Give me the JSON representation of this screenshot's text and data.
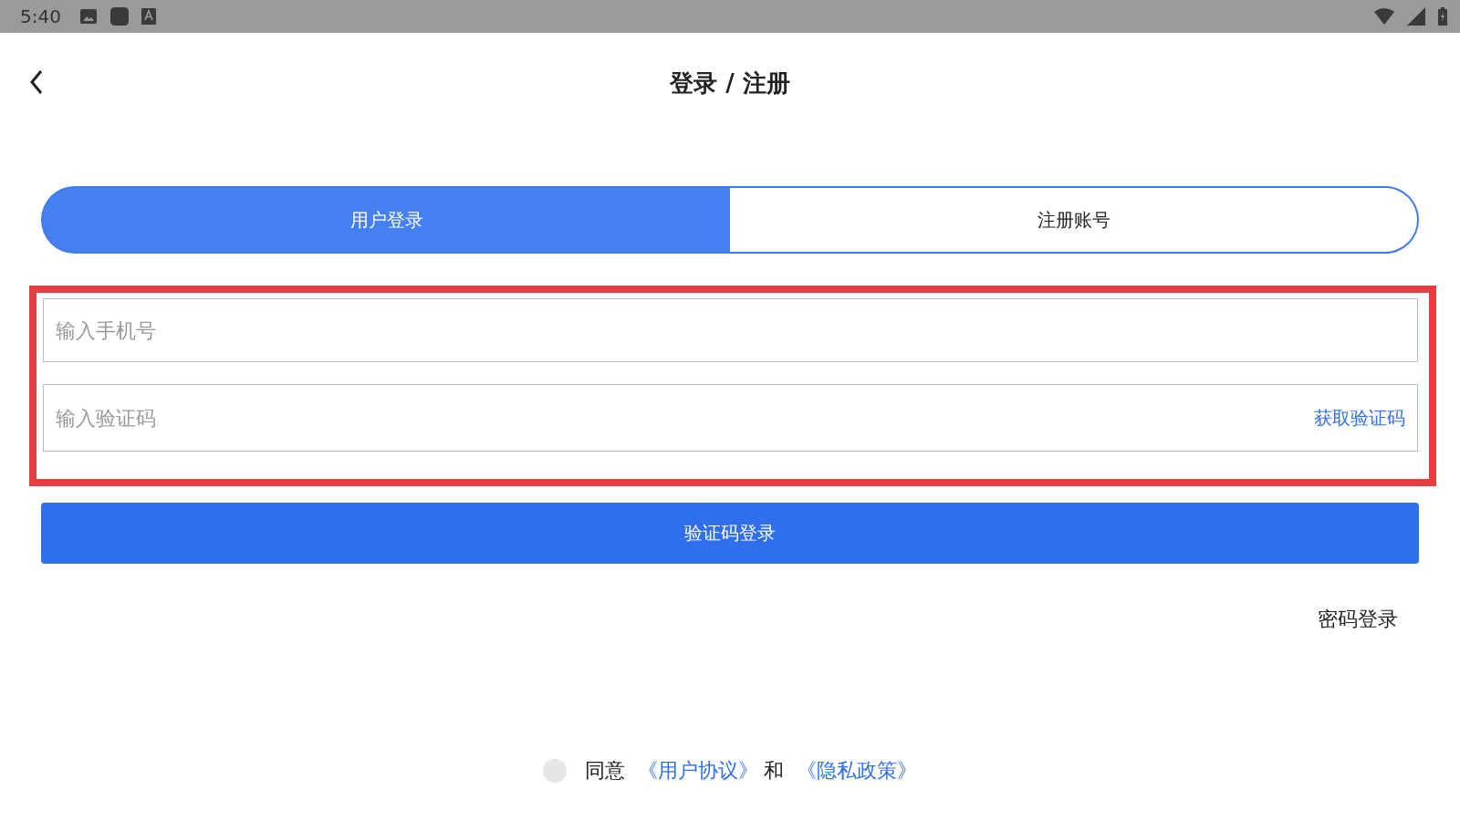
{
  "status_bar": {
    "time": "5:40"
  },
  "header": {
    "title": "登录 / 注册"
  },
  "tabs": [
    {
      "label": "用户登录",
      "selected": true
    },
    {
      "label": "注册账号",
      "selected": false
    }
  ],
  "form": {
    "phone": {
      "placeholder": "输入手机号"
    },
    "code": {
      "placeholder": "输入验证码",
      "action": "获取验证码"
    },
    "highlighted": true
  },
  "submit_button": "验证码登录",
  "alt_login_link": "密码登录",
  "agreement": {
    "checked": false,
    "prefix": "同意",
    "link_1": "《用户协议》",
    "joiner": "和",
    "link_2": "《隐私政策》"
  }
}
